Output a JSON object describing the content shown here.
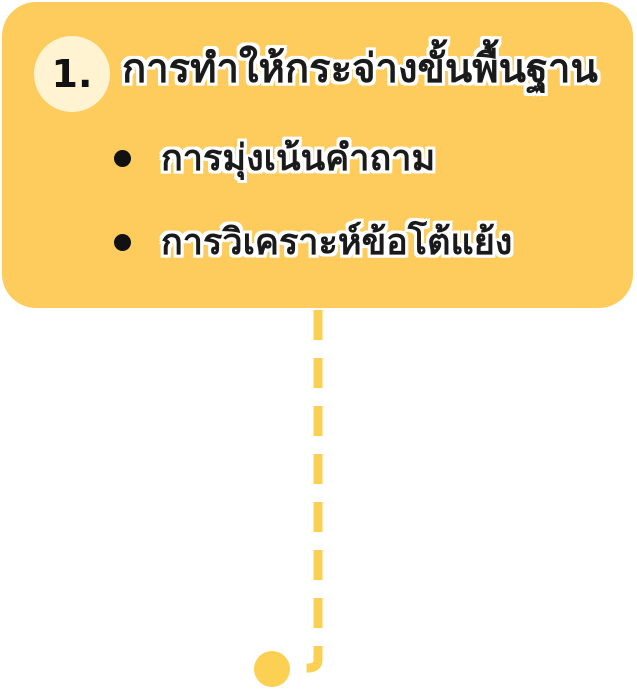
{
  "step": {
    "number": "1.",
    "title": "การทำให้กระจ่างขั้นพื้นฐาน",
    "bullets": [
      "การมุ่งเน้นคำถาม",
      "การวิเคราะห์ข้อโต้แย้ง"
    ]
  },
  "colors": {
    "card": "#fecc5c",
    "badge": "#fff3d1",
    "connector": "#fcd052"
  }
}
